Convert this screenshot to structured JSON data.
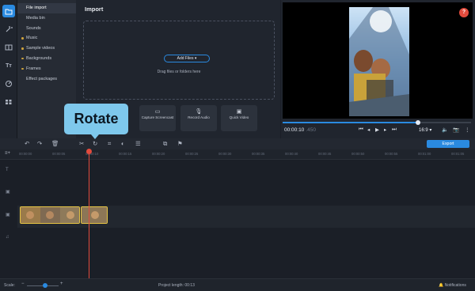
{
  "sidebar": {
    "rail_icons": [
      "import-icon",
      "magic-wand-icon",
      "transitions-icon",
      "titles-icon",
      "stickers-icon",
      "grid-icon"
    ],
    "categories": [
      {
        "label": "File import",
        "active": true,
        "dot": false
      },
      {
        "label": "Media bin",
        "active": false,
        "dot": false
      },
      {
        "label": "Sounds",
        "active": false,
        "dot": false
      },
      {
        "label": "Music",
        "active": false,
        "dot": true
      },
      {
        "label": "Sample videos",
        "active": false,
        "dot": true
      },
      {
        "label": "Backgrounds",
        "active": false,
        "dot": true
      },
      {
        "label": "Frames",
        "active": false,
        "dot": true
      },
      {
        "label": "Effect packages",
        "active": false,
        "dot": false
      }
    ]
  },
  "import": {
    "title": "Import",
    "add_files_label": "Add Files",
    "drop_hint": "Drag files or folders here",
    "tiles": [
      {
        "icon": "screen-icon",
        "label": "Capture Screencast"
      },
      {
        "icon": "mic-icon",
        "label": "Record Audio"
      },
      {
        "icon": "quick-video-icon",
        "label": "Quick Video"
      }
    ]
  },
  "preview": {
    "help_label": "?",
    "timecode": "00:00:10",
    "timecode_ms": ".450",
    "aspect_ratio": "16:9 ▾",
    "progress": 0.72
  },
  "toolbar": {
    "export_label": "Export"
  },
  "tooltip": {
    "label": "Rotate"
  },
  "timeline": {
    "ruler_ticks": [
      "00:00:00",
      "00:00:05",
      "00:00:10",
      "00:00:15",
      "00:00:20",
      "00:00:25",
      "00:00:30",
      "00:00:35",
      "00:00:40",
      "00:00:45",
      "00:00:50",
      "00:00:55",
      "00:01:00",
      "00:01:05"
    ]
  },
  "status": {
    "scale_label": "Scale:",
    "project_length_label": "Project length:",
    "project_length_value": "00:13",
    "notifications_label": "Notifications"
  },
  "colors": {
    "accent": "#2a8ae0",
    "playhead": "#e24b3d",
    "clip_border": "#e6c444",
    "tooltip_bg": "#7ec8ec"
  }
}
